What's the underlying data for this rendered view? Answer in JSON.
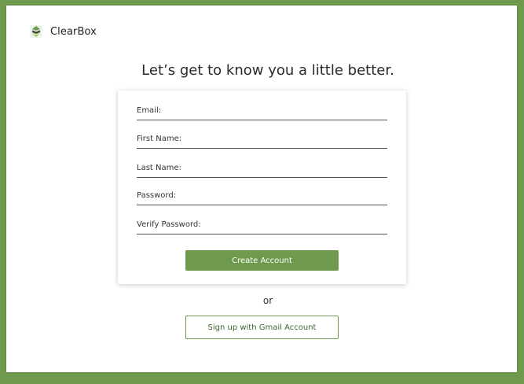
{
  "brand": {
    "name": "ClearBox",
    "icon": "clearbox-logo-icon"
  },
  "headline": "Let’s get to know you a little better.",
  "form": {
    "fields": [
      {
        "label": "Email:",
        "value": ""
      },
      {
        "label": "First Name:",
        "value": ""
      },
      {
        "label": "Last Name:",
        "value": ""
      },
      {
        "label": "Password:",
        "value": ""
      },
      {
        "label": "Verify Password:",
        "value": ""
      }
    ],
    "submit_label": "Create Account"
  },
  "divider_text": "or",
  "gmail_label": "Sign up with Gmail Account",
  "colors": {
    "accent": "#6f9a4e",
    "background": "#ffffff"
  }
}
